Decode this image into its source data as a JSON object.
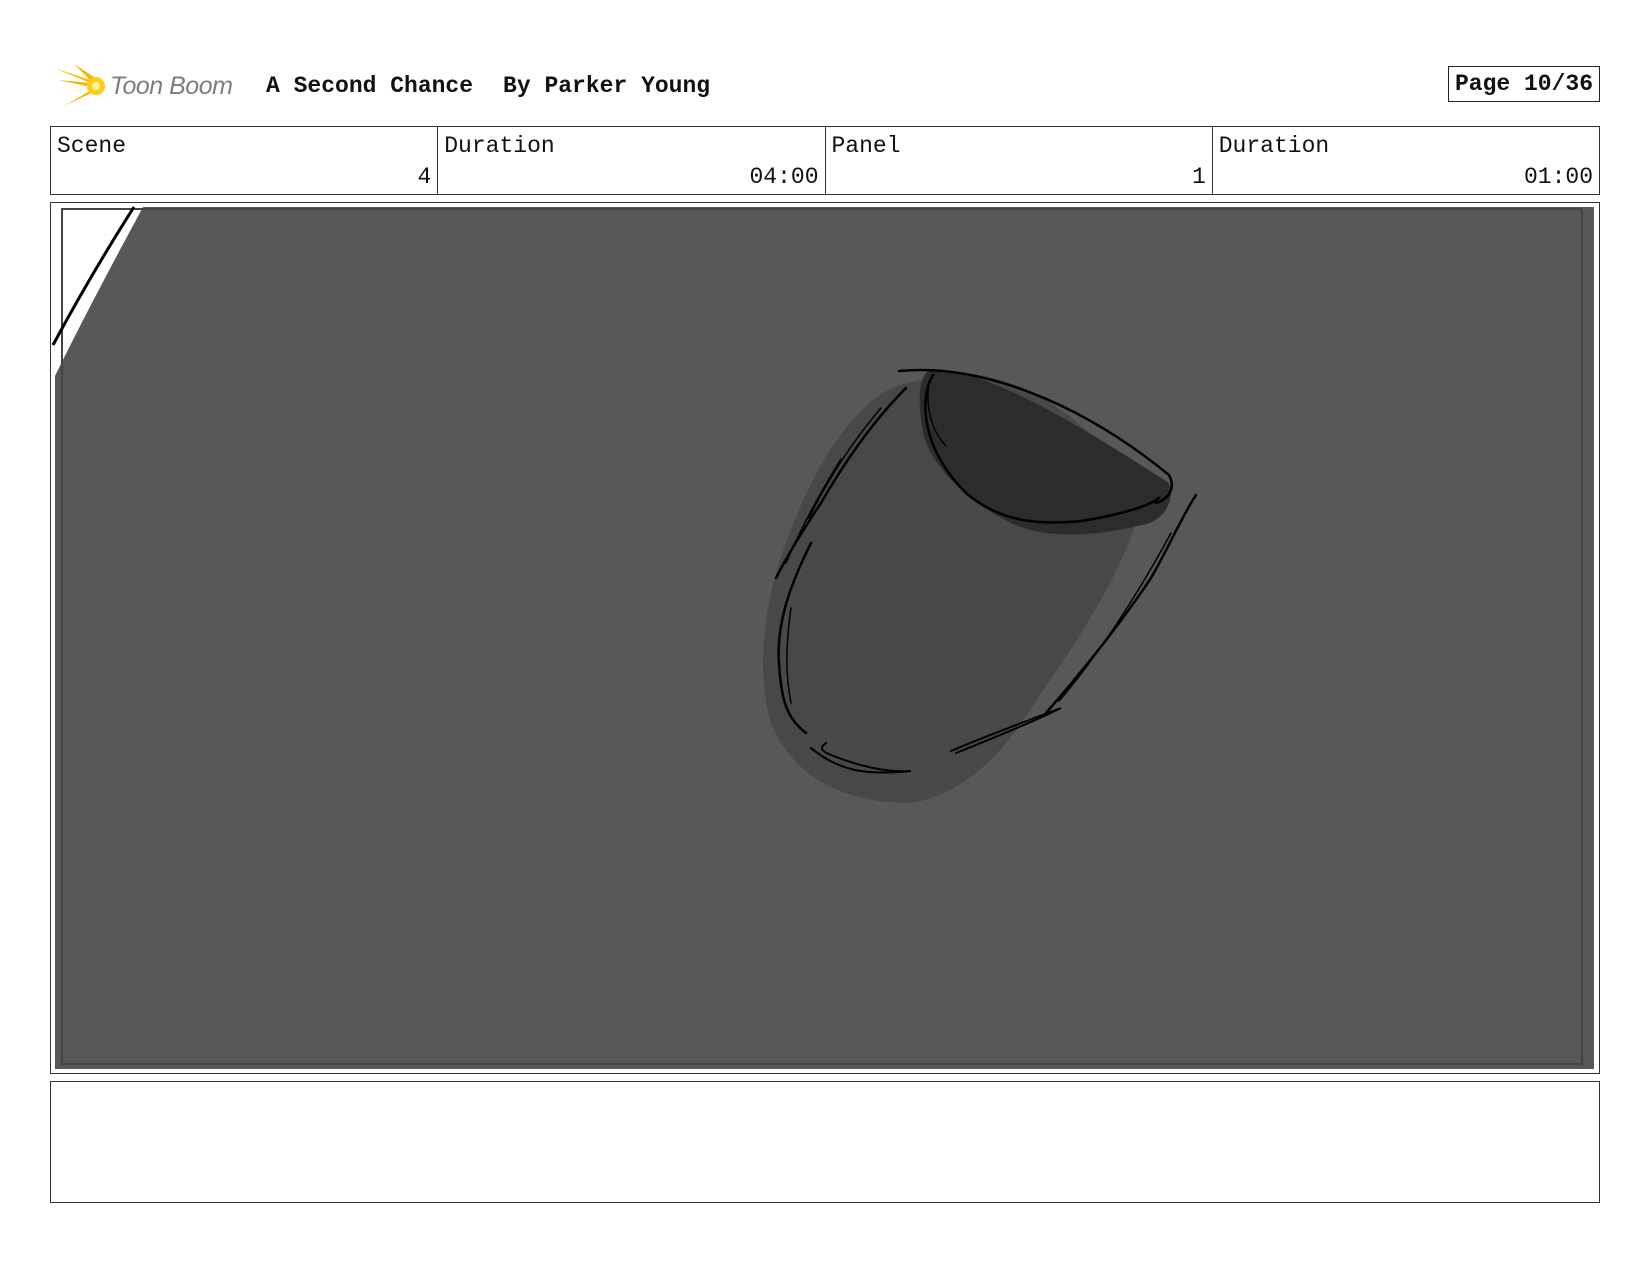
{
  "header": {
    "logo_text": "Toon Boom",
    "title": "A Second Chance",
    "author": "By Parker Young",
    "page_label": "Page 10/36"
  },
  "info": {
    "scene_label": "Scene",
    "scene_value": "4",
    "scene_duration_label": "Duration",
    "scene_duration_value": "04:00",
    "panel_label": "Panel",
    "panel_value": "1",
    "panel_duration_label": "Duration",
    "panel_duration_value": "01:00"
  },
  "notes": {
    "text": ""
  },
  "colors": {
    "panel_background": "#585858",
    "cup_body": "#484848",
    "cup_opening": "#2c2c2c",
    "logo_flare": "#f5b800"
  }
}
